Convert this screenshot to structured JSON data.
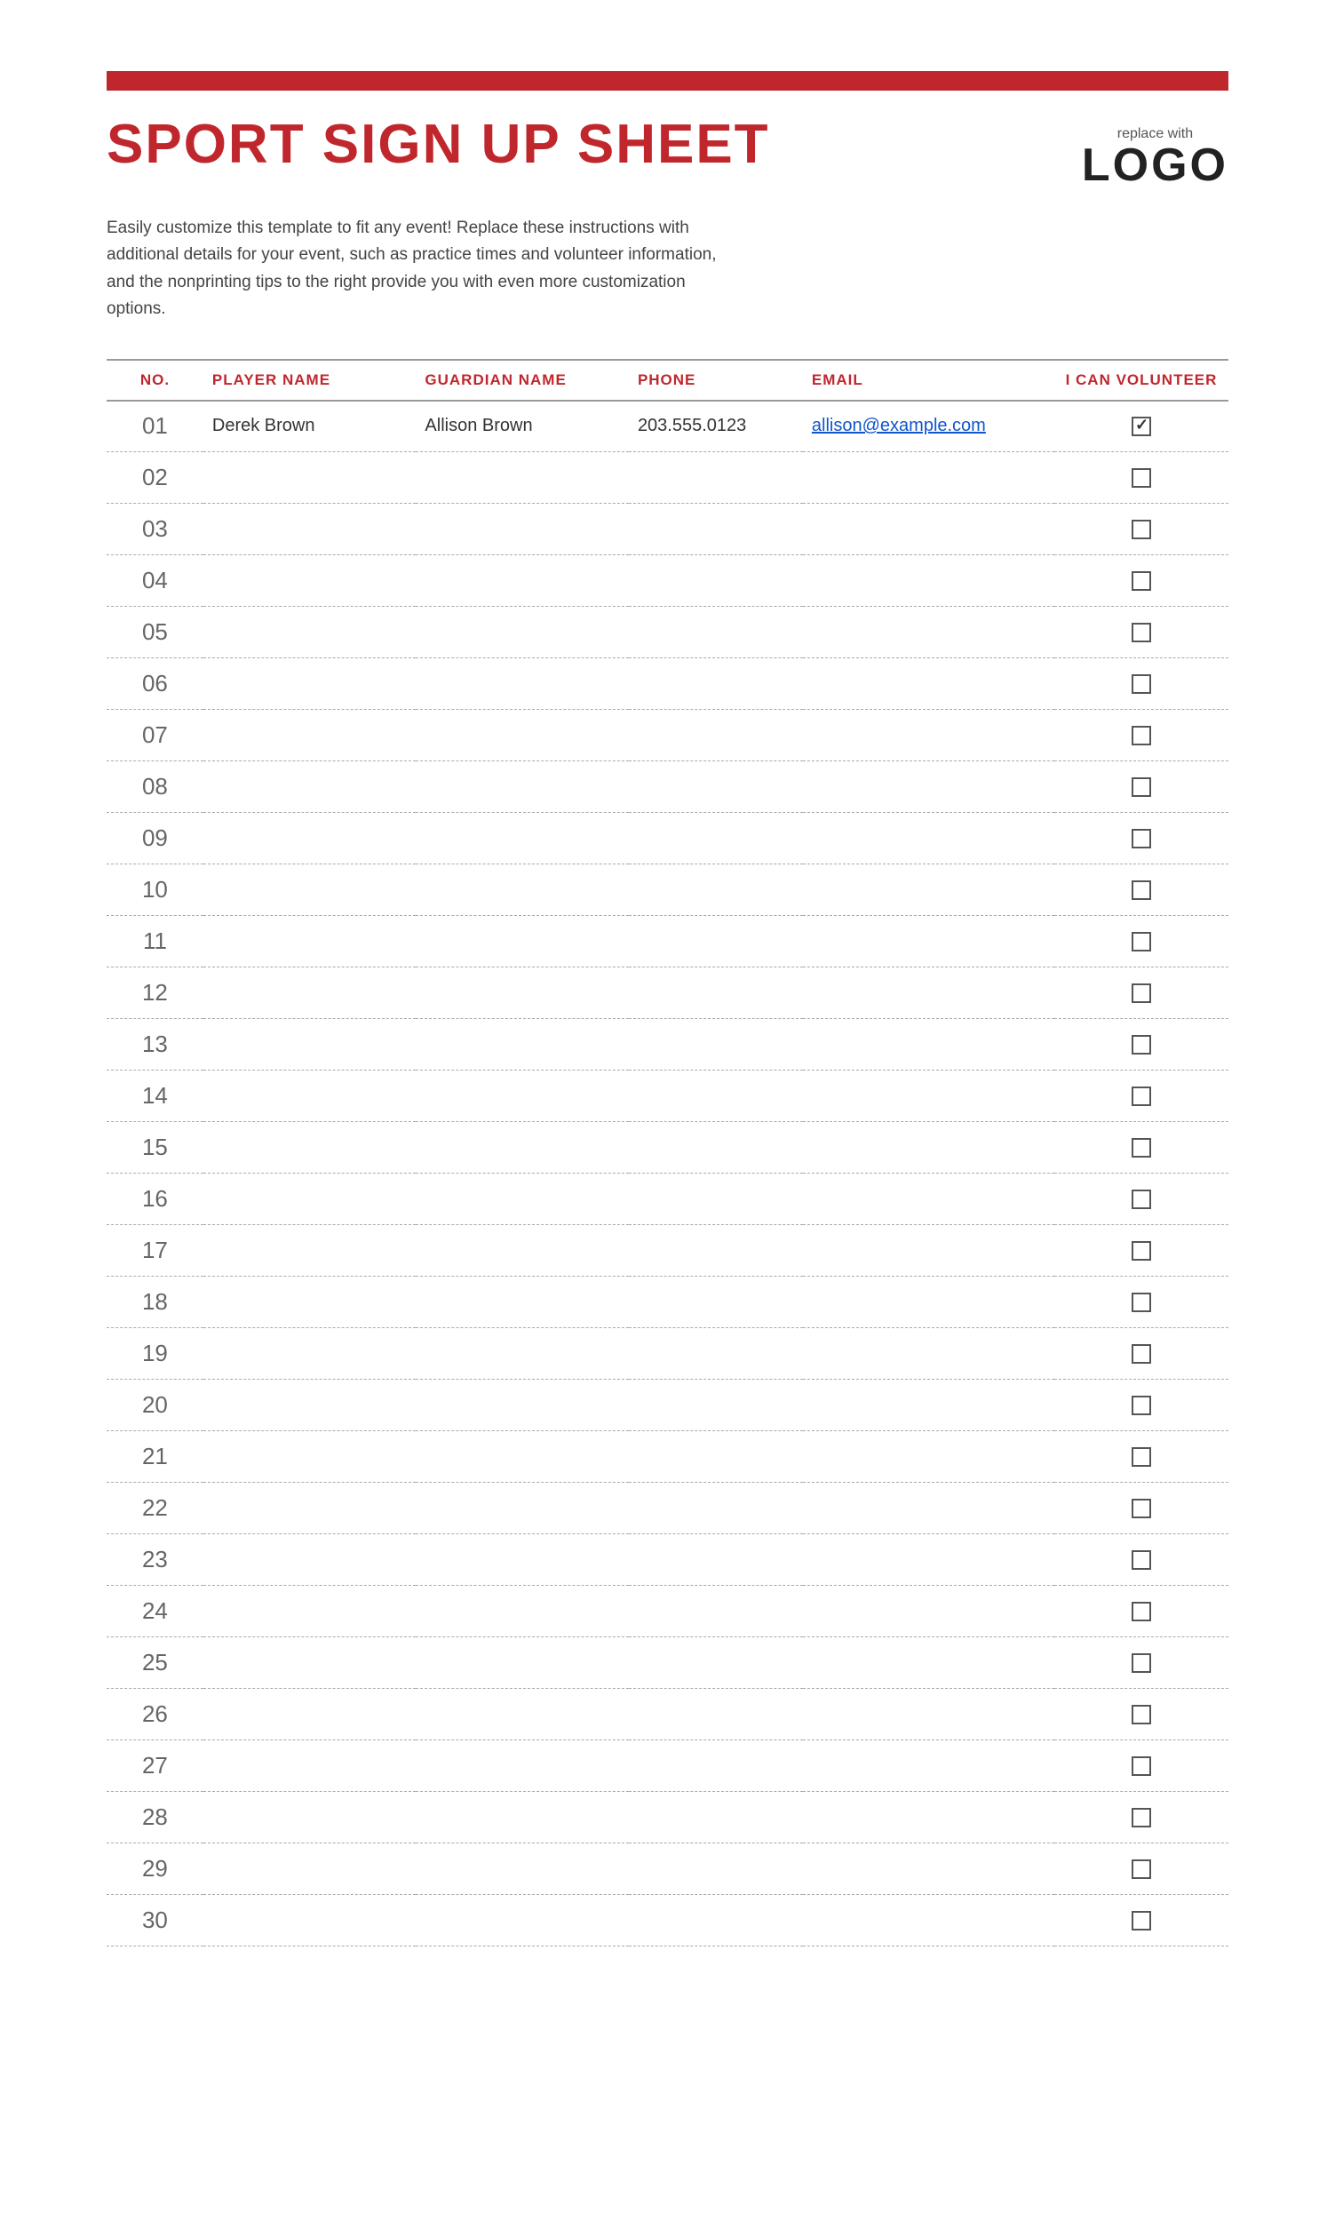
{
  "page": {
    "top_bar_color": "#c0272d",
    "title": "SPORT SIGN UP SHEET",
    "logo": {
      "replace_text": "replace with",
      "logo_word": "LOGO"
    },
    "description": "Easily customize this template to fit any event! Replace these instructions with additional details for your event, such as practice times and volunteer information, and the nonprinting tips to the right provide you with even more customization options.",
    "table": {
      "headers": [
        "NO.",
        "PLAYER NAME",
        "GUARDIAN NAME",
        "PHONE",
        "EMAIL",
        "I CAN VOLUNTEER"
      ],
      "rows": [
        {
          "no": "01",
          "player": "Derek Brown",
          "guardian": "Allison Brown",
          "phone": "203.555.0123",
          "email": "allison@example.com",
          "volunteer": true
        },
        {
          "no": "02",
          "player": "",
          "guardian": "",
          "phone": "",
          "email": "",
          "volunteer": false
        },
        {
          "no": "03",
          "player": "",
          "guardian": "",
          "phone": "",
          "email": "",
          "volunteer": false
        },
        {
          "no": "04",
          "player": "",
          "guardian": "",
          "phone": "",
          "email": "",
          "volunteer": false
        },
        {
          "no": "05",
          "player": "",
          "guardian": "",
          "phone": "",
          "email": "",
          "volunteer": false
        },
        {
          "no": "06",
          "player": "",
          "guardian": "",
          "phone": "",
          "email": "",
          "volunteer": false
        },
        {
          "no": "07",
          "player": "",
          "guardian": "",
          "phone": "",
          "email": "",
          "volunteer": false
        },
        {
          "no": "08",
          "player": "",
          "guardian": "",
          "phone": "",
          "email": "",
          "volunteer": false
        },
        {
          "no": "09",
          "player": "",
          "guardian": "",
          "phone": "",
          "email": "",
          "volunteer": false
        },
        {
          "no": "10",
          "player": "",
          "guardian": "",
          "phone": "",
          "email": "",
          "volunteer": false
        },
        {
          "no": "11",
          "player": "",
          "guardian": "",
          "phone": "",
          "email": "",
          "volunteer": false
        },
        {
          "no": "12",
          "player": "",
          "guardian": "",
          "phone": "",
          "email": "",
          "volunteer": false
        },
        {
          "no": "13",
          "player": "",
          "guardian": "",
          "phone": "",
          "email": "",
          "volunteer": false
        },
        {
          "no": "14",
          "player": "",
          "guardian": "",
          "phone": "",
          "email": "",
          "volunteer": false
        },
        {
          "no": "15",
          "player": "",
          "guardian": "",
          "phone": "",
          "email": "",
          "volunteer": false
        },
        {
          "no": "16",
          "player": "",
          "guardian": "",
          "phone": "",
          "email": "",
          "volunteer": false
        },
        {
          "no": "17",
          "player": "",
          "guardian": "",
          "phone": "",
          "email": "",
          "volunteer": false
        },
        {
          "no": "18",
          "player": "",
          "guardian": "",
          "phone": "",
          "email": "",
          "volunteer": false
        },
        {
          "no": "19",
          "player": "",
          "guardian": "",
          "phone": "",
          "email": "",
          "volunteer": false
        },
        {
          "no": "20",
          "player": "",
          "guardian": "",
          "phone": "",
          "email": "",
          "volunteer": false
        },
        {
          "no": "21",
          "player": "",
          "guardian": "",
          "phone": "",
          "email": "",
          "volunteer": false
        },
        {
          "no": "22",
          "player": "",
          "guardian": "",
          "phone": "",
          "email": "",
          "volunteer": false
        },
        {
          "no": "23",
          "player": "",
          "guardian": "",
          "phone": "",
          "email": "",
          "volunteer": false
        },
        {
          "no": "24",
          "player": "",
          "guardian": "",
          "phone": "",
          "email": "",
          "volunteer": false
        },
        {
          "no": "25",
          "player": "",
          "guardian": "",
          "phone": "",
          "email": "",
          "volunteer": false
        },
        {
          "no": "26",
          "player": "",
          "guardian": "",
          "phone": "",
          "email": "",
          "volunteer": false
        },
        {
          "no": "27",
          "player": "",
          "guardian": "",
          "phone": "",
          "email": "",
          "volunteer": false
        },
        {
          "no": "28",
          "player": "",
          "guardian": "",
          "phone": "",
          "email": "",
          "volunteer": false
        },
        {
          "no": "29",
          "player": "",
          "guardian": "",
          "phone": "",
          "email": "",
          "volunteer": false
        },
        {
          "no": "30",
          "player": "",
          "guardian": "",
          "phone": "",
          "email": "",
          "volunteer": false
        }
      ]
    }
  }
}
